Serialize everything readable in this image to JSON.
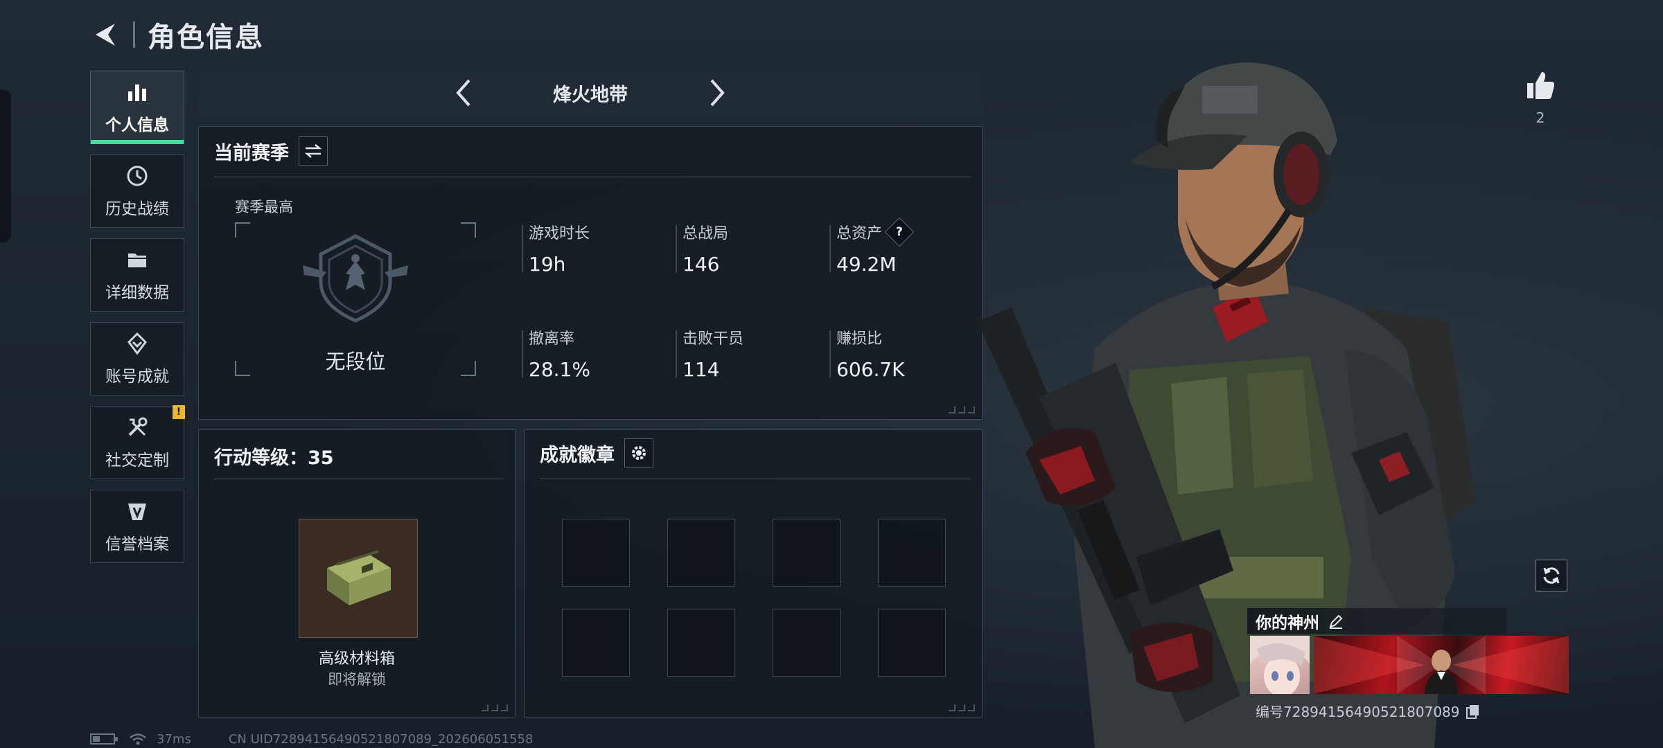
{
  "header": {
    "title": "角色信息"
  },
  "sidebar": {
    "items": [
      {
        "label": "个人信息",
        "icon": "bar-chart-icon",
        "active": true
      },
      {
        "label": "历史战绩",
        "icon": "history-clock-icon"
      },
      {
        "label": "详细数据",
        "icon": "folder-icon"
      },
      {
        "label": "账号成就",
        "icon": "achievement-icon"
      },
      {
        "label": "社交定制",
        "icon": "tools-icon",
        "badge": "!"
      },
      {
        "label": "信誉档案",
        "icon": "credit-shield-icon"
      }
    ]
  },
  "mode": {
    "title": "烽火地带"
  },
  "season": {
    "title": "当前赛季",
    "best_label": "赛季最高",
    "rank": "无段位",
    "stats": [
      {
        "label": "游戏时长",
        "value": "19h"
      },
      {
        "label": "总战局",
        "value": "146"
      },
      {
        "label": "总资产",
        "value": "49.2M"
      },
      {
        "label": "撤离率",
        "value": "28.1%"
      },
      {
        "label": "击败干员",
        "value": "114"
      },
      {
        "label": "赚损比",
        "value": "606.7K"
      }
    ],
    "help_glyph": "?"
  },
  "level": {
    "title": "行动等级：35",
    "reward_name": "高级材料箱",
    "reward_status": "即将解锁"
  },
  "badges": {
    "title": "成就徽章"
  },
  "likes": {
    "count": "2"
  },
  "card": {
    "title": "你的神州",
    "uid": "编号7289415649052180708​9"
  },
  "status_bar": {
    "ping": "37ms",
    "footer_uid": "CN UID7289415649052180708​9_202606051558"
  },
  "colors": {
    "accent": "#3fe0a0",
    "badge": "#e9b830",
    "banner": "#b0141c"
  }
}
